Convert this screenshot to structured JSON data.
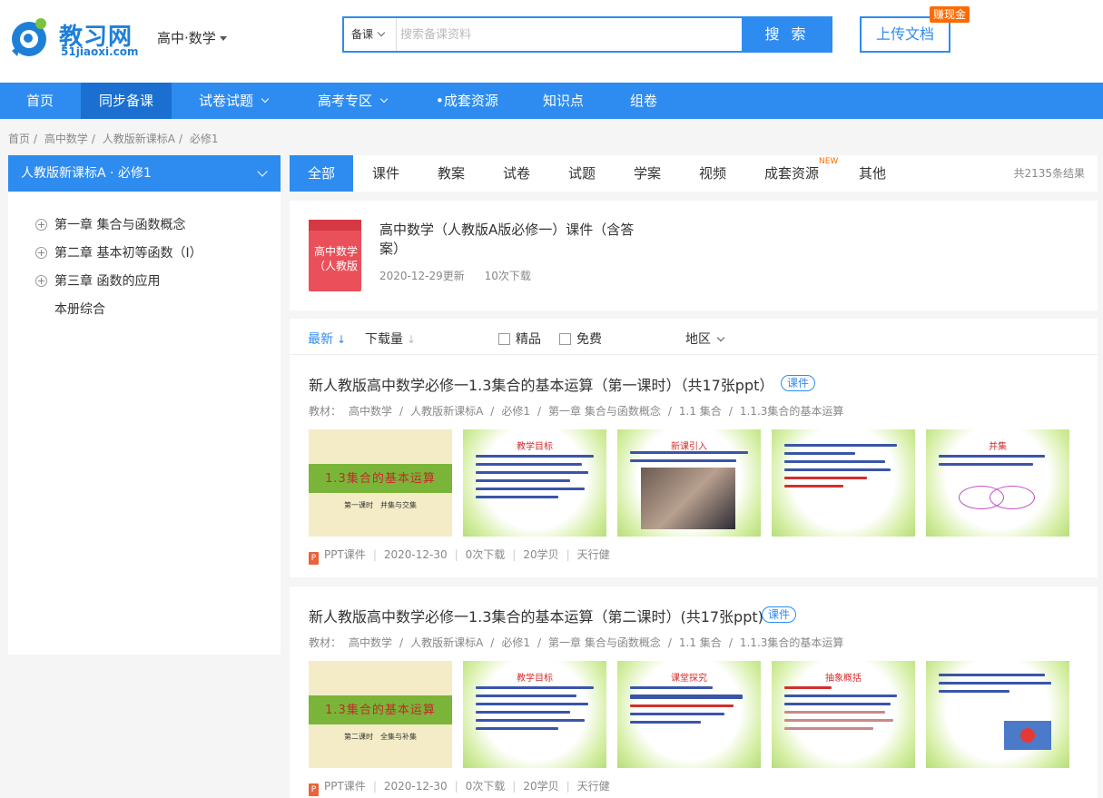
{
  "header": {
    "logo_text": "教习网",
    "logo_sub": "51jiaoxi.com",
    "subject": "高中·数学",
    "search": {
      "type": "备课",
      "placeholder": "搜索备课资料",
      "button": "搜 索"
    },
    "upload": "上传文档",
    "earn_badge": "赚现金"
  },
  "nav": {
    "items": [
      {
        "label": "首页"
      },
      {
        "label": "同步备课"
      },
      {
        "label": "试卷试题"
      },
      {
        "label": "高考专区"
      },
      {
        "label": "•成套资源"
      },
      {
        "label": "知识点"
      },
      {
        "label": "组卷"
      }
    ]
  },
  "breadcrumb": [
    "首页",
    "/",
    "高中数学",
    "/",
    "人教版新课标A",
    "/",
    "必修1"
  ],
  "sidebar": {
    "header": "人教版新课标A · 必修1",
    "chapters": [
      "第一章 集合与函数概念",
      "第二章 基本初等函数（Ⅰ）",
      "第三章 函数的应用"
    ],
    "extra": "本册综合"
  },
  "tabs": {
    "items": [
      "全部",
      "课件",
      "教案",
      "试卷",
      "试题",
      "学案",
      "视频",
      "成套资源",
      "其他"
    ],
    "new_badge": "NEW",
    "result_count": "共2135条结果"
  },
  "featured": {
    "cover_text": "高中数学（人教版",
    "title": "高中数学（人教版A版必修一）课件（含答案）",
    "date": "2020-12-29更新",
    "downloads": "10次下载"
  },
  "filters": {
    "latest": "最新",
    "downloads": "下载量",
    "premium": "精品",
    "free": "免费",
    "region": "地区"
  },
  "items": [
    {
      "title": "新人教版高中数学必修一1.3集合的基本运算（第一课时）（共17张ppt）",
      "tag": "课件",
      "path": [
        "教材：",
        "高中数学",
        "/",
        "人教版新课标A",
        "/",
        "必修1",
        "/",
        "第一章 集合与函数概念",
        "/",
        "1.1 集合",
        "/",
        "1.1.3集合的基本运算"
      ],
      "cover_title": "1.3集合的基本运算",
      "cover_sub": "第一课时　并集与交集",
      "slides": [
        "教学目标",
        "新课引入",
        "",
        "并集"
      ],
      "meta": {
        "type": "PPT课件",
        "date": "2020-12-30",
        "downloads": "0次下载",
        "price": "20学贝",
        "author": "天行健"
      }
    },
    {
      "title": "新人教版高中数学必修一1.3集合的基本运算（第二课时）(共17张ppt)",
      "tag": "课件",
      "path": [
        "教材：",
        "高中数学",
        "/",
        "人教版新课标A",
        "/",
        "必修1",
        "/",
        "第一章 集合与函数概念",
        "/",
        "1.1 集合",
        "/",
        "1.1.3集合的基本运算"
      ],
      "cover_title": "1.3集合的基本运算",
      "cover_sub": "第二课时　全集与补集",
      "slides": [
        "教学目标",
        "课堂探究",
        "抽象概括",
        ""
      ],
      "meta": {
        "type": "PPT课件",
        "date": "2020-12-30",
        "downloads": "0次下载",
        "price": "20学贝",
        "author": "天行健"
      }
    }
  ],
  "colors": {
    "brand": "#2e8cf0",
    "nav_active": "#1a6fd0",
    "badge": "#ff6a00"
  }
}
